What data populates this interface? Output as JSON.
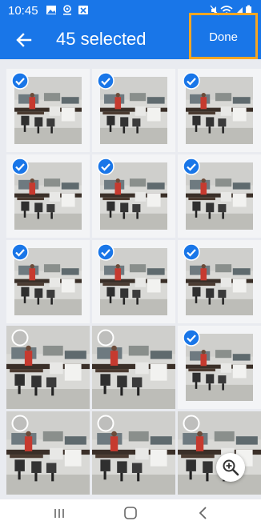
{
  "status_bar": {
    "time": "10:45",
    "left_icons": [
      "gallery-icon",
      "location-icon",
      "notification-x-icon"
    ],
    "right_icons": [
      "mute-icon",
      "wifi-icon",
      "signal-icon",
      "battery-icon"
    ]
  },
  "app_bar": {
    "title": "45 selected",
    "done_label": "Done",
    "back_icon": "arrow-left-icon"
  },
  "colors": {
    "primary": "#1976e8",
    "highlight_border": "#f5a623",
    "grid_bg": "#e9ebf0"
  },
  "photos": [
    {
      "selected": true
    },
    {
      "selected": true
    },
    {
      "selected": true
    },
    {
      "selected": true
    },
    {
      "selected": true
    },
    {
      "selected": true
    },
    {
      "selected": true
    },
    {
      "selected": true
    },
    {
      "selected": true
    },
    {
      "selected": false
    },
    {
      "selected": false
    },
    {
      "selected": true
    },
    {
      "selected": false
    },
    {
      "selected": false
    },
    {
      "selected": false
    }
  ],
  "zoom_icon": "zoom-in-icon",
  "nav_bar": {
    "items": [
      "recent-apps-icon",
      "home-icon",
      "back-icon"
    ]
  }
}
